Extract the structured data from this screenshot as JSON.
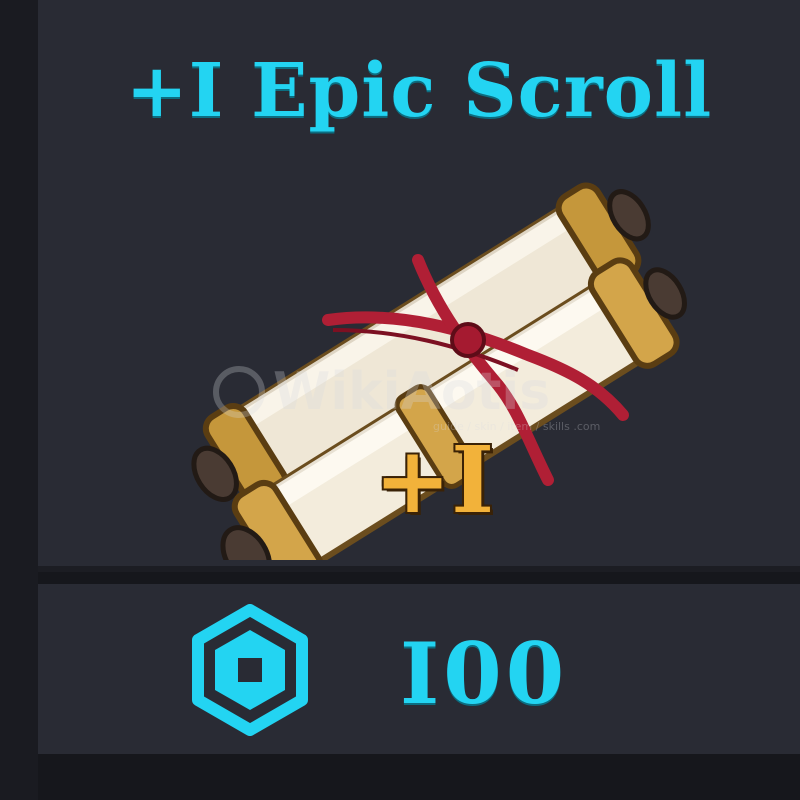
{
  "item": {
    "title": "+I Epic Scroll",
    "badge": "+I",
    "icon": "double-scroll-icon"
  },
  "watermark": {
    "brand": "WikiAotis",
    "tagline": "guide / skin / item / skills .com"
  },
  "price": {
    "currency_icon": "robux-hexagon-icon",
    "amount": "I00"
  },
  "colors": {
    "accent": "#23d4f2",
    "panel": "#292b34",
    "background": "#16171c",
    "gold": "#f2b23a",
    "ribbon": "#b01f35"
  }
}
